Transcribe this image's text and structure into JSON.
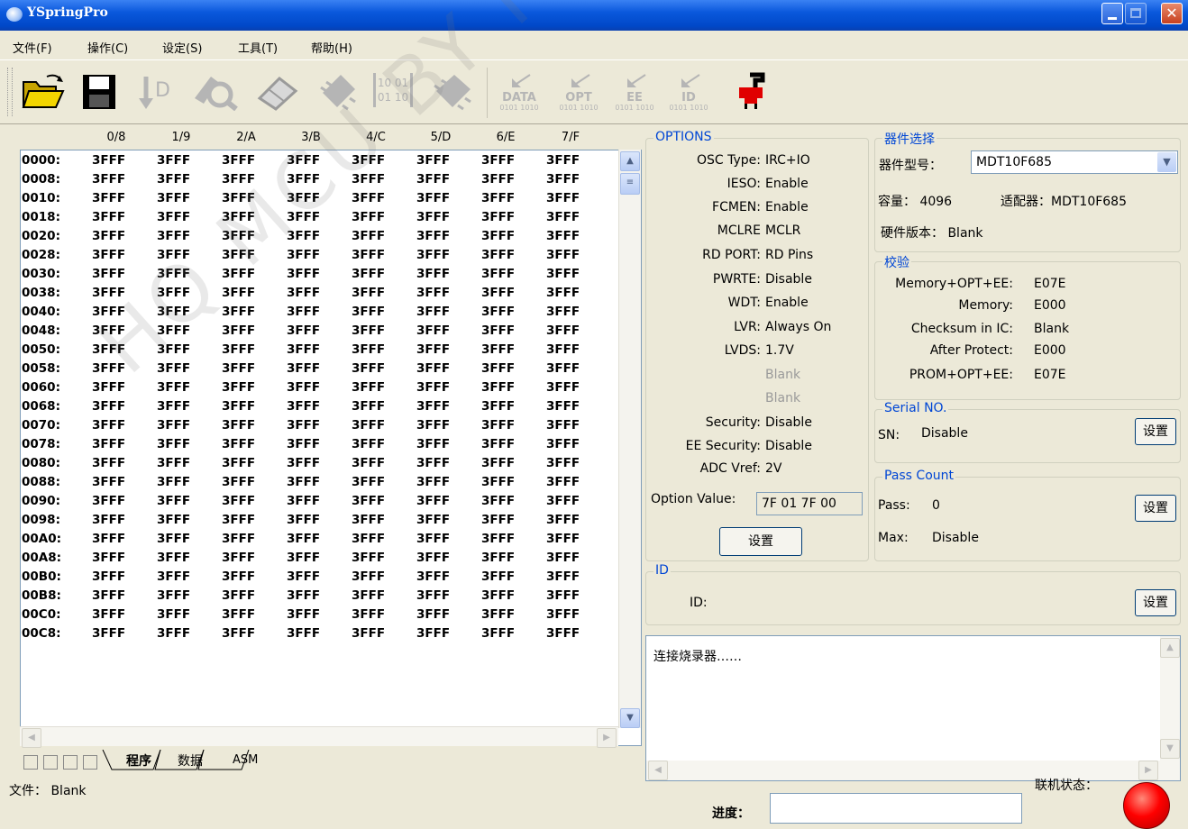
{
  "window": {
    "title": "YSpringPro"
  },
  "menu": [
    "文件(F)",
    "操作(C)",
    "设定(S)",
    "工具(T)",
    "帮助(H)"
  ],
  "toolbar": {
    "hex_icon_text": "10 01\n01 10",
    "data_label": "DATA",
    "opt_label": "OPT",
    "ee_label": "EE",
    "id_label": "ID",
    "bits_label": "0101 1010"
  },
  "hex": {
    "col_headers": [
      "0/8",
      "1/9",
      "2/A",
      "3/B",
      "4/C",
      "5/D",
      "6/E",
      "7/F"
    ],
    "rows": [
      {
        "addr": "0000:",
        "cells": [
          "3FFF",
          "3FFF",
          "3FFF",
          "3FFF",
          "3FFF",
          "3FFF",
          "3FFF",
          "3FFF"
        ]
      },
      {
        "addr": "0008:",
        "cells": [
          "3FFF",
          "3FFF",
          "3FFF",
          "3FFF",
          "3FFF",
          "3FFF",
          "3FFF",
          "3FFF"
        ]
      },
      {
        "addr": "0010:",
        "cells": [
          "3FFF",
          "3FFF",
          "3FFF",
          "3FFF",
          "3FFF",
          "3FFF",
          "3FFF",
          "3FFF"
        ]
      },
      {
        "addr": "0018:",
        "cells": [
          "3FFF",
          "3FFF",
          "3FFF",
          "3FFF",
          "3FFF",
          "3FFF",
          "3FFF",
          "3FFF"
        ]
      },
      {
        "addr": "0020:",
        "cells": [
          "3FFF",
          "3FFF",
          "3FFF",
          "3FFF",
          "3FFF",
          "3FFF",
          "3FFF",
          "3FFF"
        ]
      },
      {
        "addr": "0028:",
        "cells": [
          "3FFF",
          "3FFF",
          "3FFF",
          "3FFF",
          "3FFF",
          "3FFF",
          "3FFF",
          "3FFF"
        ]
      },
      {
        "addr": "0030:",
        "cells": [
          "3FFF",
          "3FFF",
          "3FFF",
          "3FFF",
          "3FFF",
          "3FFF",
          "3FFF",
          "3FFF"
        ]
      },
      {
        "addr": "0038:",
        "cells": [
          "3FFF",
          "3FFF",
          "3FFF",
          "3FFF",
          "3FFF",
          "3FFF",
          "3FFF",
          "3FFF"
        ]
      },
      {
        "addr": "0040:",
        "cells": [
          "3FFF",
          "3FFF",
          "3FFF",
          "3FFF",
          "3FFF",
          "3FFF",
          "3FFF",
          "3FFF"
        ]
      },
      {
        "addr": "0048:",
        "cells": [
          "3FFF",
          "3FFF",
          "3FFF",
          "3FFF",
          "3FFF",
          "3FFF",
          "3FFF",
          "3FFF"
        ]
      },
      {
        "addr": "0050:",
        "cells": [
          "3FFF",
          "3FFF",
          "3FFF",
          "3FFF",
          "3FFF",
          "3FFF",
          "3FFF",
          "3FFF"
        ]
      },
      {
        "addr": "0058:",
        "cells": [
          "3FFF",
          "3FFF",
          "3FFF",
          "3FFF",
          "3FFF",
          "3FFF",
          "3FFF",
          "3FFF"
        ]
      },
      {
        "addr": "0060:",
        "cells": [
          "3FFF",
          "3FFF",
          "3FFF",
          "3FFF",
          "3FFF",
          "3FFF",
          "3FFF",
          "3FFF"
        ]
      },
      {
        "addr": "0068:",
        "cells": [
          "3FFF",
          "3FFF",
          "3FFF",
          "3FFF",
          "3FFF",
          "3FFF",
          "3FFF",
          "3FFF"
        ]
      },
      {
        "addr": "0070:",
        "cells": [
          "3FFF",
          "3FFF",
          "3FFF",
          "3FFF",
          "3FFF",
          "3FFF",
          "3FFF",
          "3FFF"
        ]
      },
      {
        "addr": "0078:",
        "cells": [
          "3FFF",
          "3FFF",
          "3FFF",
          "3FFF",
          "3FFF",
          "3FFF",
          "3FFF",
          "3FFF"
        ]
      },
      {
        "addr": "0080:",
        "cells": [
          "3FFF",
          "3FFF",
          "3FFF",
          "3FFF",
          "3FFF",
          "3FFF",
          "3FFF",
          "3FFF"
        ]
      },
      {
        "addr": "0088:",
        "cells": [
          "3FFF",
          "3FFF",
          "3FFF",
          "3FFF",
          "3FFF",
          "3FFF",
          "3FFF",
          "3FFF"
        ]
      },
      {
        "addr": "0090:",
        "cells": [
          "3FFF",
          "3FFF",
          "3FFF",
          "3FFF",
          "3FFF",
          "3FFF",
          "3FFF",
          "3FFF"
        ]
      },
      {
        "addr": "0098:",
        "cells": [
          "3FFF",
          "3FFF",
          "3FFF",
          "3FFF",
          "3FFF",
          "3FFF",
          "3FFF",
          "3FFF"
        ]
      },
      {
        "addr": "00A0:",
        "cells": [
          "3FFF",
          "3FFF",
          "3FFF",
          "3FFF",
          "3FFF",
          "3FFF",
          "3FFF",
          "3FFF"
        ]
      },
      {
        "addr": "00A8:",
        "cells": [
          "3FFF",
          "3FFF",
          "3FFF",
          "3FFF",
          "3FFF",
          "3FFF",
          "3FFF",
          "3FFF"
        ]
      },
      {
        "addr": "00B0:",
        "cells": [
          "3FFF",
          "3FFF",
          "3FFF",
          "3FFF",
          "3FFF",
          "3FFF",
          "3FFF",
          "3FFF"
        ]
      },
      {
        "addr": "00B8:",
        "cells": [
          "3FFF",
          "3FFF",
          "3FFF",
          "3FFF",
          "3FFF",
          "3FFF",
          "3FFF",
          "3FFF"
        ]
      },
      {
        "addr": "00C0:",
        "cells": [
          "3FFF",
          "3FFF",
          "3FFF",
          "3FFF",
          "3FFF",
          "3FFF",
          "3FFF",
          "3FFF"
        ]
      },
      {
        "addr": "00C8:",
        "cells": [
          "3FFF",
          "3FFF",
          "3FFF",
          "3FFF",
          "3FFF",
          "3FFF",
          "3FFF",
          "3FFF"
        ]
      }
    ]
  },
  "tabs": {
    "program": "程序",
    "data": "数据",
    "asm": "ASM"
  },
  "status": {
    "file": "文件：  Blank",
    "progress_label": "进度：",
    "link_label": "联机状态：",
    "link_color": "#ff0000"
  },
  "options": {
    "title": "OPTIONS",
    "fields": [
      {
        "label": "OSC Type:",
        "value": "IRC+IO"
      },
      {
        "label": "IESO:",
        "value": "Enable"
      },
      {
        "label": "FCMEN:",
        "value": "Enable"
      },
      {
        "label": "MCLRE",
        "value": "MCLR"
      },
      {
        "label": "RD PORT:",
        "value": "RD Pins"
      },
      {
        "label": "PWRTE:",
        "value": "Disable"
      },
      {
        "label": "WDT:",
        "value": "Enable"
      },
      {
        "label": "LVR:",
        "value": "Always On"
      },
      {
        "label": "LVDS:",
        "value": "1.7V"
      },
      {
        "label": "",
        "value": "Blank"
      },
      {
        "label": "",
        "value": "Blank"
      },
      {
        "label": "Security:",
        "value": "Disable"
      },
      {
        "label": "EE Security:",
        "value": "Disable"
      },
      {
        "label": "ADC Vref:",
        "value": "2V"
      }
    ],
    "option_value_label": "Option Value:",
    "option_value": "7F 01 7F 00",
    "set_button": "设置"
  },
  "device": {
    "title": "器件选择",
    "model_label": "器件型号：",
    "model": "MDT10F685",
    "capacity": "容量：  4096",
    "adapter": "适配器：MDT10F685",
    "hw_version": "硬件版本：  Blank"
  },
  "verify": {
    "title": "校验",
    "rows": [
      {
        "label": "Memory+OPT+EE:",
        "value": "E07E"
      },
      {
        "label": "Memory:",
        "value": "E000"
      },
      {
        "label": "Checksum in IC:",
        "value": "Blank"
      },
      {
        "label": "After Protect:",
        "value": "E000"
      },
      {
        "label": "PROM+OPT+EE:",
        "value": "E07E"
      }
    ]
  },
  "serial": {
    "title": "Serial NO.",
    "sn_label": "SN:",
    "sn_value": "Disable",
    "set_button": "设置"
  },
  "pass_count": {
    "title": "Pass Count",
    "pass_label": "Pass:",
    "pass_value": "0",
    "max_label": "Max:",
    "max_value": "Disable",
    "set_button": "设置"
  },
  "id_group": {
    "title": "ID",
    "id_label": "ID:",
    "set_button": "设置"
  },
  "log": {
    "text": "连接烧录器……"
  },
  "watermark": "HQ MCU BY HQ"
}
